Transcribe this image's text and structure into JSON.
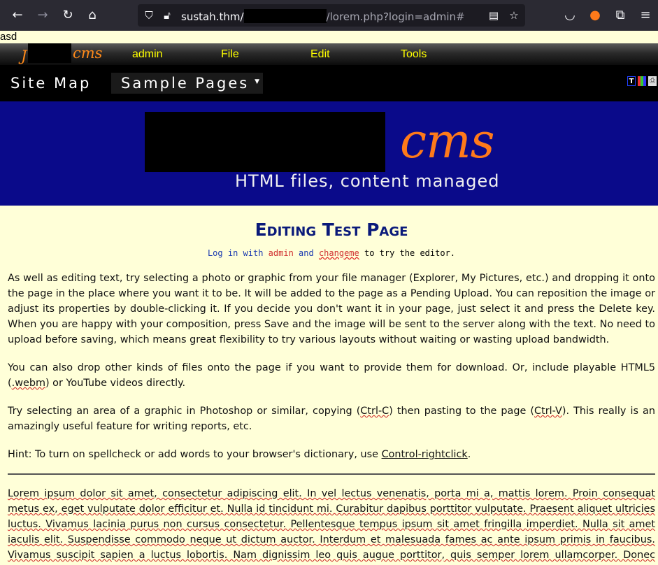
{
  "browser": {
    "url_host": "sustah.thm/",
    "url_path": "/lorem.php?login=admin#"
  },
  "stray_text": "asd",
  "cms_toolbar": {
    "logo_text": "cms",
    "user": "admin",
    "menus": [
      "File",
      "Edit",
      "Tools"
    ]
  },
  "site_nav": {
    "site_map": "Site Map",
    "sample_pages": "Sample Pages"
  },
  "banner": {
    "logo_text": "cms",
    "tagline": "HTML files, content managed"
  },
  "page": {
    "title": "Editing Test Page",
    "login_hint": {
      "prefix": "Log in with",
      "user": "admin",
      "conj": "and",
      "password": "changeme",
      "suffix": "to try the editor."
    },
    "para1": "As well as editing text, try selecting a photo or graphic from your file manager (Explorer, My Pictures, etc.) and dropping it onto the page in the place where you want it to be.  It will be added to the page as a Pending Upload. You can reposition the image or adjust its properties by double-clicking it. If you decide you don't want it in your page, just select it and press the Delete key.  When you are happy with your composition, press Save and the image will be sent to the server along with the text. No need to upload before saving, which means great flexibility to try various layouts without waiting or wasting upload bandwidth.",
    "para2_a": "You can also drop other kinds of files onto the page if you want to provide them for download. Or, include playable HTML5 (",
    "para2_b": ".webm",
    "para2_c": ") or YouTube videos directly.",
    "para3_a": "Try selecting an area of a graphic in Photoshop or similar, copying (",
    "para3_b": "Ctrl-C",
    "para3_c": ") then pasting to the page (",
    "para3_d": "Ctrl-V",
    "para3_e": "). This really is an amazingly useful feature for writing reports, etc.",
    "hint_a": "Hint: To turn on spellcheck or add words to your browser's dictionary, use ",
    "hint_b": "Control-rightclick",
    "hint_c": ".",
    "lorem": "Lorem ipsum dolor sit amet, consectetur adipiscing elit. In vel lectus venenatis, porta mi a, mattis lorem. Proin consequat metus ex, eget vulputate dolor efficitur et. Nulla id tincidunt mi. Curabitur dapibus porttitor vulputate. Praesent aliquet ultricies luctus. Vivamus lacinia purus non cursus consectetur. Pellentesque tempus ipsum sit amet fringilla imperdiet. Nulla sit amet iaculis elit. Suspendisse commodo neque ut dictum auctor. Interdum et malesuada fames ac ante ipsum primis in faucibus. Vivamus suscipit sapien a luctus lobortis. Nam dignissim leo quis augue porttitor, quis semper lorem ullamcorper. Donec semper quam at enim volutpat tincidunt."
  }
}
